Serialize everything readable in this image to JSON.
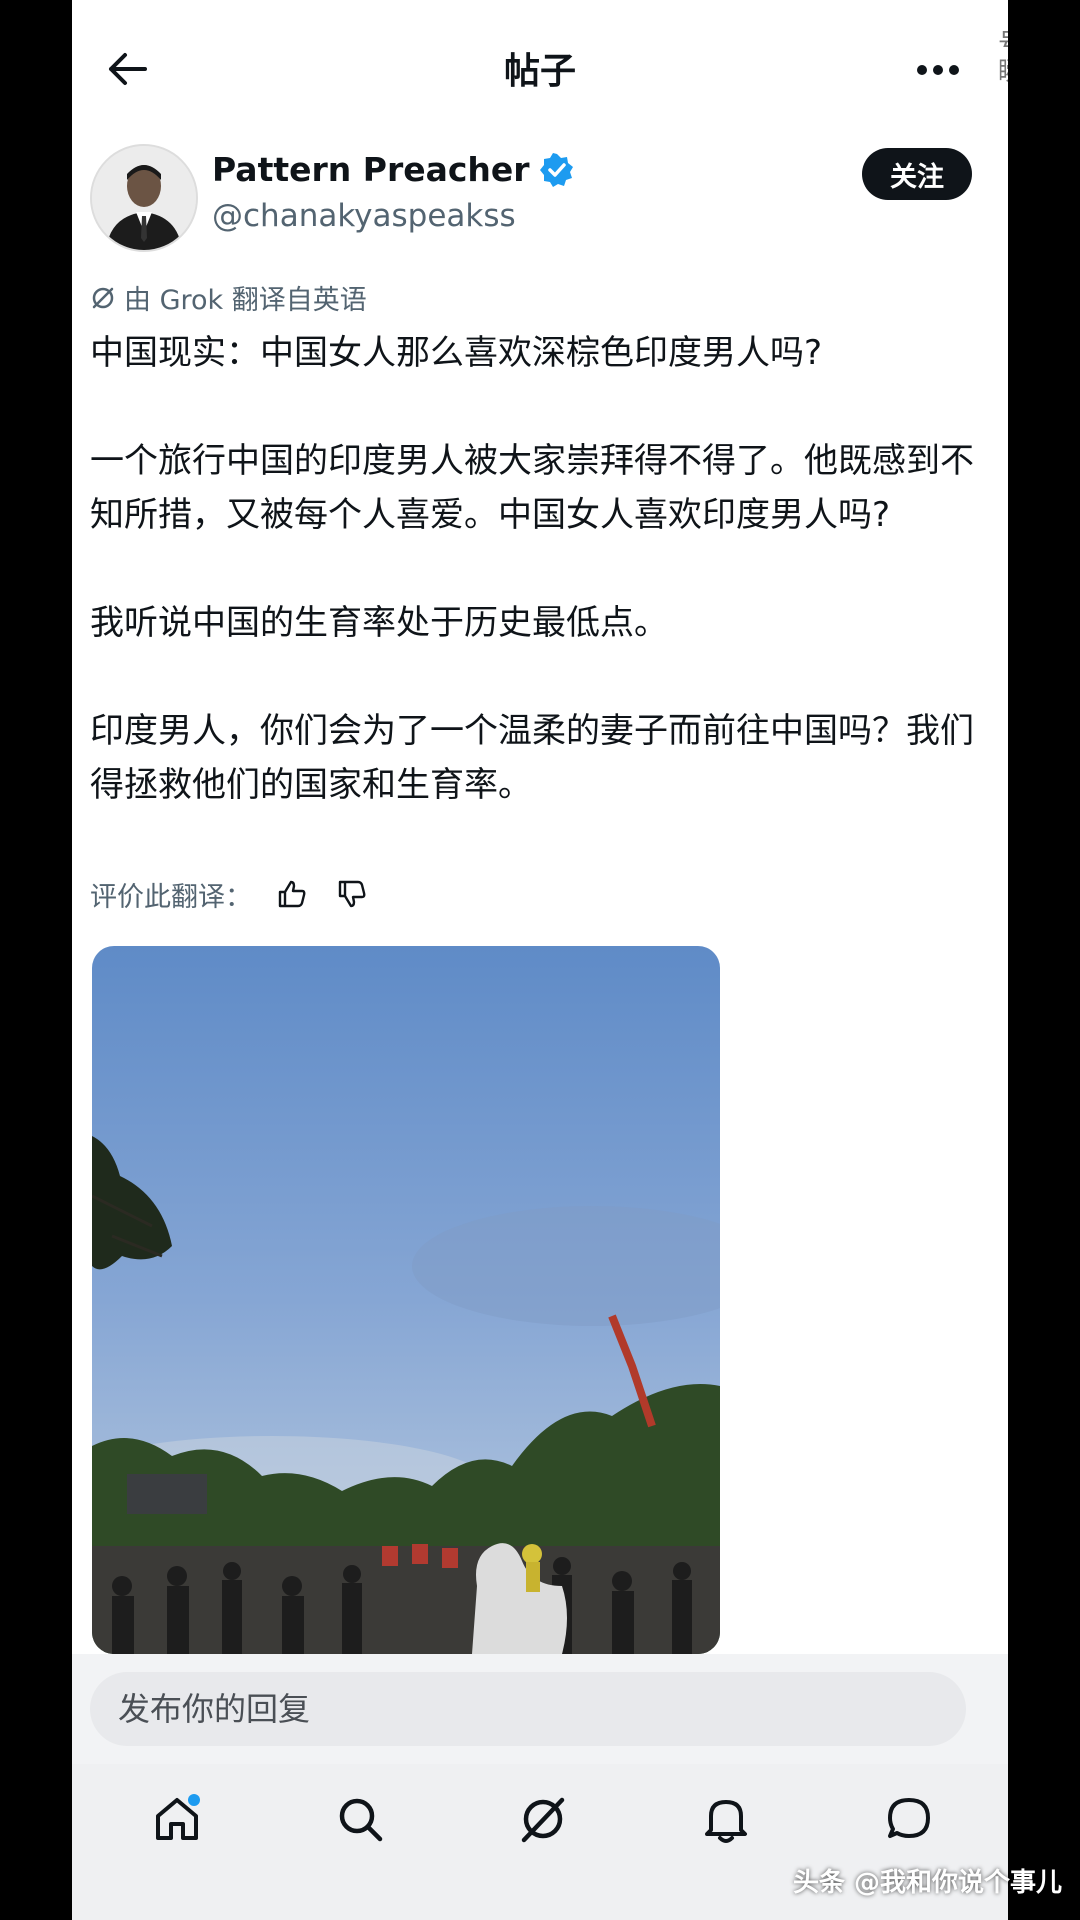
{
  "header": {
    "title": "帖子",
    "edge_glyph": "号\n瞬"
  },
  "author": {
    "name": "Pattern Preacher",
    "handle": "@chanakyaspeakss",
    "verified": true,
    "follow_label": "关注"
  },
  "translation": {
    "note": "由 Grok 翻译自英语",
    "rate_label": "评价此翻译："
  },
  "post": {
    "paragraphs": [
      "中国现实：中国女人那么喜欢深棕色印度男人吗?",
      "一个旅行中国的印度男人被大家崇拜得不得了。他既感到不知所措，又被每个人喜爱。中国女人喜欢印度男人吗?",
      "我听说中国的生育率处于历史最低点。",
      "印度男人，你们会为了一个温柔的妻子而前往中国吗？我们得拯救他们的国家和生育率。"
    ]
  },
  "reply": {
    "placeholder": "发布你的回复"
  },
  "nav": {
    "items": [
      "home-icon",
      "search-icon",
      "grok-icon",
      "notifications-icon",
      "messages-icon"
    ]
  },
  "watermark": "头条 @我和你说个事儿",
  "colors": {
    "text": "#0f1419",
    "secondary": "#536471",
    "verified": "#1d9bf0",
    "follow_bg": "#0f1419"
  }
}
